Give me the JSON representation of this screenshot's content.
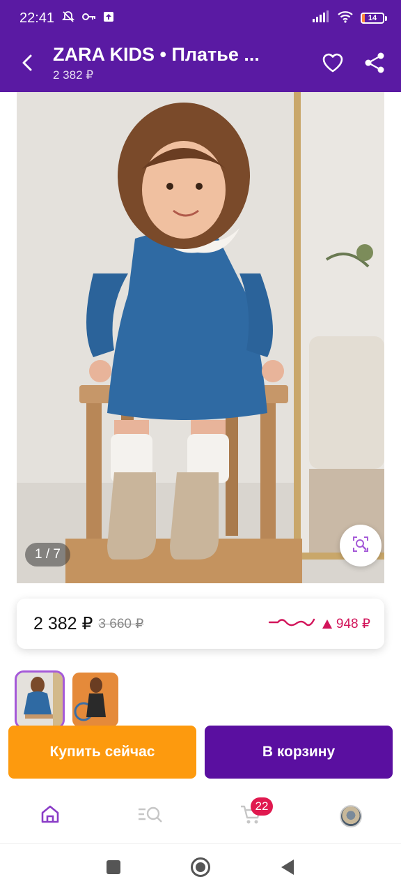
{
  "status_bar": {
    "time": "22:41",
    "battery_level": "14",
    "icons": [
      "bell-off-icon",
      "key-icon",
      "upload-icon",
      "signal-icon",
      "wifi-icon",
      "battery-icon"
    ]
  },
  "app_bar": {
    "title": "ZARA KIDS • Платье ...",
    "subtitle": "2 382 ₽",
    "icons": [
      "back-arrow-icon",
      "heart-icon",
      "share-icon"
    ]
  },
  "gallery": {
    "page_indicator": "1 / 7",
    "lens_icon": "visual-search-icon"
  },
  "price": {
    "current": "2 382 ₽",
    "old": "3 660 ₽",
    "change": "948 ₽",
    "trend_icon": "price-history-sparkline-icon"
  },
  "thumbnails": {
    "count_visible": 2,
    "selected_index": 0
  },
  "actions": {
    "buy_now": "Купить сейчас",
    "add_to_cart": "В корзину"
  },
  "bottom_nav": {
    "items": [
      "home-icon",
      "catalog-search-icon",
      "cart-icon",
      "profile-avatar"
    ],
    "cart_badge": "22"
  },
  "colors": {
    "brand": "#5a1aa3",
    "buy_button": "#fd9a0e",
    "cart_button": "#5a0fa0",
    "price_drop": "#d2145a",
    "badge": "#e0194f"
  }
}
